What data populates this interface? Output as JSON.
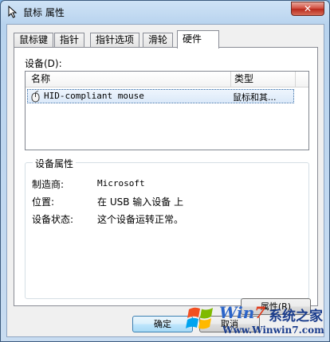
{
  "window": {
    "title": "鼠标 属性",
    "close_glyph": "✕"
  },
  "tabs": [
    {
      "label": "鼠标键",
      "active": false
    },
    {
      "label": "指针",
      "active": false
    },
    {
      "label": "指针选项",
      "active": false
    },
    {
      "label": "滑轮",
      "active": false
    },
    {
      "label": "硬件",
      "active": true
    }
  ],
  "hardware": {
    "devices_label": "设备(D):",
    "columns": {
      "name": "名称",
      "type": "类型"
    },
    "devices": [
      {
        "name": "HID-compliant mouse",
        "type": "鼠标和其...",
        "icon": "mouse-icon"
      }
    ],
    "group_title": "设备属性",
    "properties": [
      {
        "label": "制造商:",
        "value": "Microsoft"
      },
      {
        "label": "位置:",
        "value": "在 USB 输入设备 上"
      },
      {
        "label": "设备状态:",
        "value": "这个设备运转正常。"
      }
    ],
    "properties_button": "属性(R)"
  },
  "dialog_buttons": {
    "ok": "确定",
    "cancel": "取消"
  },
  "watermark": {
    "brand_w": "Win",
    "brand_7": "7",
    "cn": "系统之家",
    "url": "Www.Winwin7.com"
  },
  "colors": {
    "title_gradient_top": "#cfe3f6",
    "close_red": "#c8402f",
    "selection_border": "#3a6ea5",
    "ok_border": "#3c7fb1"
  }
}
